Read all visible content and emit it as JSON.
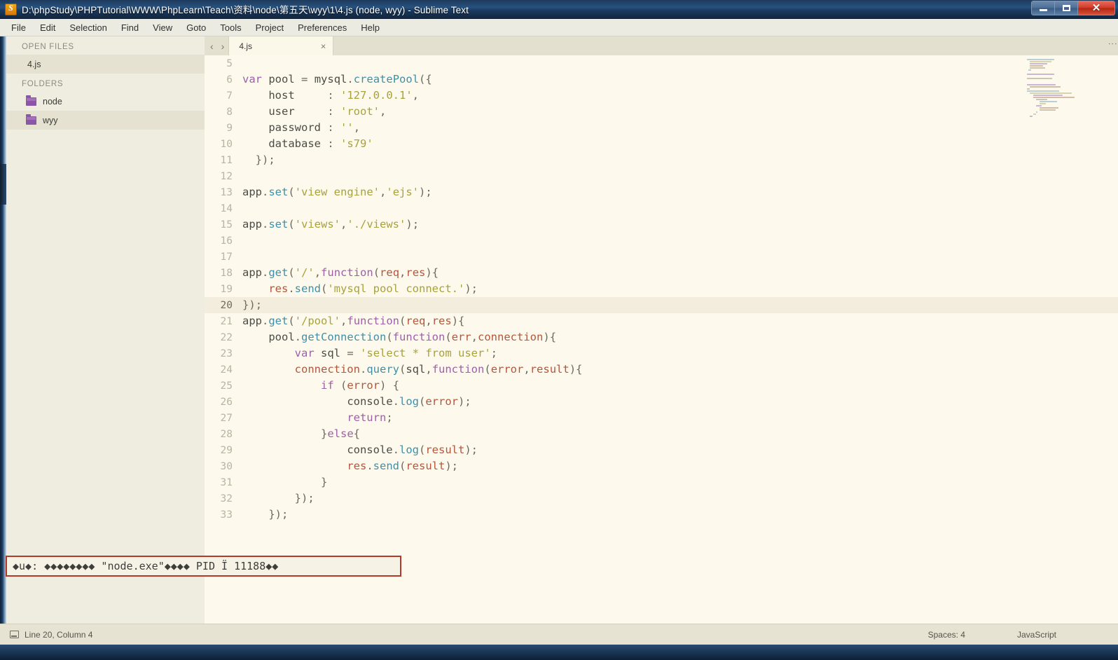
{
  "window": {
    "title": "D:\\phpStudy\\PHPTutorial\\WWW\\PhpLearn\\Teach\\资料\\node\\第五天\\wyy\\1\\4.js (node, wyy) - Sublime Text",
    "app_icon": "sublime-text-icon",
    "minimize_label": "",
    "maximize_label": "",
    "close_label": "✕"
  },
  "menubar": {
    "items": [
      {
        "label": "File"
      },
      {
        "label": "Edit"
      },
      {
        "label": "Selection"
      },
      {
        "label": "Find"
      },
      {
        "label": "View"
      },
      {
        "label": "Goto"
      },
      {
        "label": "Tools"
      },
      {
        "label": "Project"
      },
      {
        "label": "Preferences"
      },
      {
        "label": "Help"
      }
    ]
  },
  "sidebar": {
    "open_files_header": "OPEN FILES",
    "open_files": [
      {
        "label": "4.js",
        "active": true
      }
    ],
    "folders_header": "FOLDERS",
    "folders": [
      {
        "label": "node",
        "icon": "folder-icon",
        "active": false
      },
      {
        "label": "wyy",
        "icon": "folder-icon",
        "active": true
      }
    ],
    "nav_prev": "‹",
    "nav_next": "›"
  },
  "tabs": {
    "items": [
      {
        "label": "4.js",
        "close": "×",
        "active": true
      }
    ],
    "overflow_icon": "more-options-icon"
  },
  "editor": {
    "cursor_line": 20,
    "language": "JavaScript",
    "lines": [
      {
        "n": 5,
        "text": ""
      },
      {
        "n": 6,
        "text": "var pool = mysql.createPool({"
      },
      {
        "n": 7,
        "text": "    host     : '127.0.0.1',"
      },
      {
        "n": 8,
        "text": "    user     : 'root',"
      },
      {
        "n": 9,
        "text": "    password : '',"
      },
      {
        "n": 10,
        "text": "    database : 's79'"
      },
      {
        "n": 11,
        "text": "  });"
      },
      {
        "n": 12,
        "text": ""
      },
      {
        "n": 13,
        "text": "app.set('view engine','ejs');"
      },
      {
        "n": 14,
        "text": ""
      },
      {
        "n": 15,
        "text": "app.set('views','./views');"
      },
      {
        "n": 16,
        "text": ""
      },
      {
        "n": 17,
        "text": ""
      },
      {
        "n": 18,
        "text": "app.get('/',function(req,res){"
      },
      {
        "n": 19,
        "text": "    res.send('mysql pool connect.');"
      },
      {
        "n": 20,
        "text": "});"
      },
      {
        "n": 21,
        "text": "app.get('/pool',function(req,res){"
      },
      {
        "n": 22,
        "text": "    pool.getConnection(function(err,connection){"
      },
      {
        "n": 23,
        "text": "        var sql = 'select * from user';"
      },
      {
        "n": 24,
        "text": "        connection.query(sql,function(error,result){"
      },
      {
        "n": 25,
        "text": "            if (error) {"
      },
      {
        "n": 26,
        "text": "                console.log(error);"
      },
      {
        "n": 27,
        "text": "                return;"
      },
      {
        "n": 28,
        "text": "            }else{"
      },
      {
        "n": 29,
        "text": "                console.log(result);"
      },
      {
        "n": 30,
        "text": "                res.send(result);"
      },
      {
        "n": 31,
        "text": "            }"
      },
      {
        "n": 32,
        "text": "        });"
      },
      {
        "n": 33,
        "text": "    });"
      }
    ]
  },
  "console_overlay": {
    "text": "◆u◆: ◆◆◆◆◆◆◆◆ \"node.exe\"◆◆◆◆ PID Ï 11188◆◆",
    "border_color": "#b33a2b"
  },
  "statusbar": {
    "position": "Line 20, Column 4",
    "indent": "Spaces: 4",
    "syntax": "JavaScript",
    "icon": "document-icon"
  },
  "colors": {
    "editor_bg": "#fdf9ec",
    "sidebar_bg": "#efece0",
    "accent_purple": "#8d55a8",
    "title_gradient_top": "#27527f",
    "close_red": "#cf3b28",
    "string_yellow": "#a8a23c",
    "keyword_purple": "#9e5fa8",
    "function_blue": "#3f8fa8",
    "param_orange": "#b4553c"
  }
}
